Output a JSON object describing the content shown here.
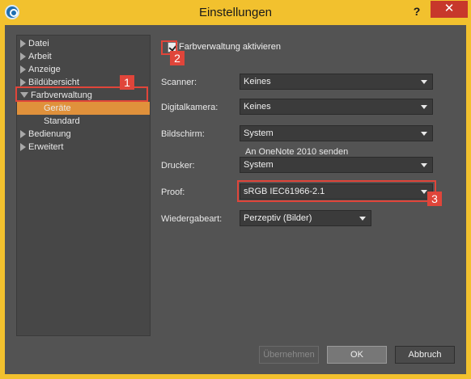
{
  "window": {
    "title": "Einstellungen",
    "help_label": "?",
    "close_label": "✕"
  },
  "tree": {
    "items": [
      {
        "label": "Datei"
      },
      {
        "label": "Arbeit"
      },
      {
        "label": "Anzeige"
      },
      {
        "label": "Bildübersicht"
      },
      {
        "label": "Farbverwaltung"
      },
      {
        "label": "Geräte"
      },
      {
        "label": "Standard"
      },
      {
        "label": "Bedienung"
      },
      {
        "label": "Erweitert"
      }
    ]
  },
  "color_management": {
    "enable_label": "Farbverwaltung aktivieren",
    "enabled": true,
    "scanner_label": "Scanner:",
    "scanner_value": "Keines",
    "camera_label": "Digitalkamera:",
    "camera_value": "Keines",
    "monitor_label": "Bildschirm:",
    "monitor_value": "System",
    "printer_note": "An OneNote 2010 senden",
    "printer_label": "Drucker:",
    "printer_value": "System",
    "proof_label": "Proof:",
    "proof_value": "sRGB IEC61966-2.1",
    "intent_label": "Wiedergabeart:",
    "intent_value": "Perzeptiv (Bilder)"
  },
  "callouts": {
    "one": "1",
    "two": "2",
    "three": "3"
  },
  "buttons": {
    "apply": "Übernehmen",
    "ok": "OK",
    "cancel": "Abbruch"
  },
  "colors": {
    "titlebar": "#f2c12e",
    "selection": "#e0913b",
    "callout": "#e0453a"
  }
}
